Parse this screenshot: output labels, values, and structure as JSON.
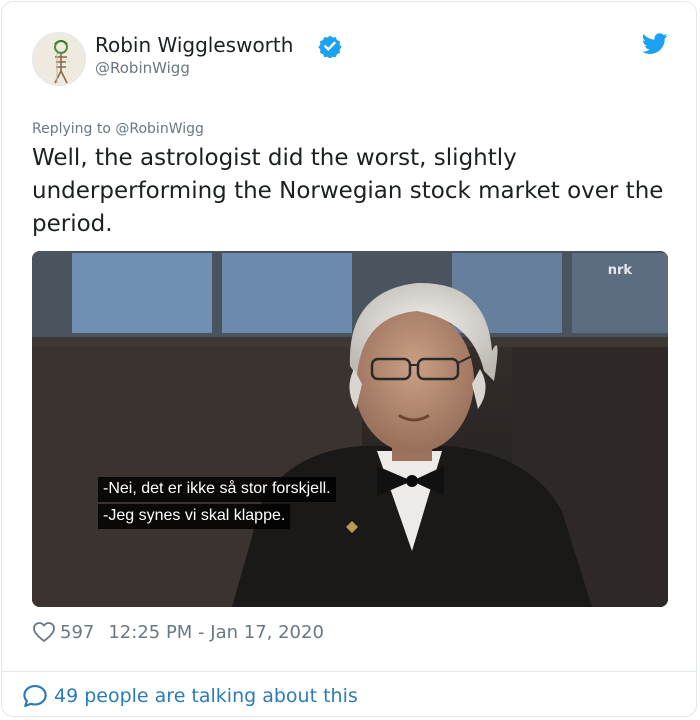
{
  "author": {
    "name": "Robin Wigglesworth",
    "handle": "@RobinWigg",
    "verified": true
  },
  "reply_context": "Replying to @RobinWigg",
  "tweet_text": "Well, the astrologist did the worst, slightly underperforming the Norwegian stock market over the period.",
  "media": {
    "broadcaster_logo": "nrk",
    "subtitles": [
      "-Nei, det er ikke så stor forskjell.",
      "-Jeg synes vi skal klappe."
    ]
  },
  "stats": {
    "likes": "597",
    "timestamp": "12:25 PM - Jan 17, 2020"
  },
  "conversation_link": "49 people are talking about this",
  "icons": [
    "verified-badge-icon",
    "twitter-bird-icon",
    "heart-icon",
    "speech-bubble-icon"
  ],
  "colors": {
    "brand_blue": "#1da1f2",
    "link_blue": "#2b7bb9",
    "muted_text": "#697882",
    "text": "#1c2022"
  }
}
